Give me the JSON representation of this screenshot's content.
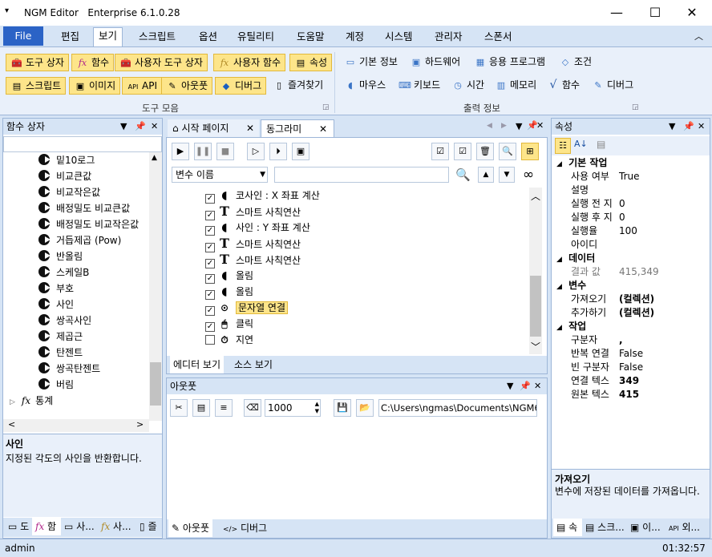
{
  "window": {
    "title": "NGM Editor   Enterprise 6.1.0.28",
    "minimize": "—",
    "maximize": "☐",
    "close": "✕"
  },
  "menu": {
    "file": "File",
    "items": [
      "편집",
      "보기",
      "스크립트",
      "옵션",
      "유틸리티",
      "도움말",
      "계정",
      "시스템",
      "관리자",
      "스폰서"
    ],
    "active_index": 1
  },
  "ribbon": {
    "toolbox_buttons": [
      {
        "label": "도구 상자",
        "icon": "toolbox-icon"
      },
      {
        "label": "함수",
        "icon": "fx-icon"
      },
      {
        "label": "사용자 도구 상자",
        "icon": "user-toolbox-icon"
      },
      {
        "label": "사용자 함수",
        "icon": "user-fx-icon"
      },
      {
        "label": "속성",
        "icon": "properties-icon"
      },
      {
        "label": "스크립트",
        "icon": "script-icon"
      },
      {
        "label": "이미지",
        "icon": "image-icon"
      },
      {
        "label": "API",
        "icon": "api-icon"
      },
      {
        "label": "아웃풋",
        "icon": "output-icon"
      },
      {
        "label": "디버그",
        "icon": "debug-icon"
      },
      {
        "label": "즐겨찾기",
        "icon": "favorites-icon"
      }
    ],
    "toolbox_group_label": "도구 모음",
    "output_buttons": [
      {
        "label": "기본 정보",
        "icon": "monitor-icon"
      },
      {
        "label": "하드웨어",
        "icon": "hardware-icon"
      },
      {
        "label": "응용 프로그램",
        "icon": "app-icon"
      },
      {
        "label": "조건",
        "icon": "condition-icon"
      },
      {
        "label": "마우스",
        "icon": "mouse-icon"
      },
      {
        "label": "키보드",
        "icon": "keyboard-icon"
      },
      {
        "label": "시간",
        "icon": "clock-icon"
      },
      {
        "label": "메모리",
        "icon": "memory-icon"
      },
      {
        "label": "함수",
        "icon": "sqrt-icon"
      },
      {
        "label": "디버그",
        "icon": "debug-icon"
      }
    ],
    "output_group_label": "출력 정보"
  },
  "function_box": {
    "title": "함수 상자",
    "items": [
      "밑10로그",
      "비교큰값",
      "비교작은값",
      "배정밀도 비교큰값",
      "배정밀도 비교작은값",
      "거듭제곱 (Pow)",
      "반올림",
      "스케일B",
      "부호",
      "사인",
      "쌍곡사인",
      "제곱근",
      "탄젠트",
      "쌍곡탄젠트",
      "버림"
    ],
    "category": "통계",
    "desc_title": "사인",
    "desc_text": "지정된 각도의 사인을 반환합니다.",
    "bottom_tabs": [
      "도",
      "함",
      "사...",
      "사...",
      "즐"
    ]
  },
  "editor": {
    "tabs": [
      "시작 페이지",
      "동그라미"
    ],
    "variable_select": "변수 이름",
    "search_value": "",
    "rows": [
      {
        "checked": true,
        "icon": "pac",
        "text": "코사인 : X 좌표 계산"
      },
      {
        "checked": true,
        "icon": "T",
        "text": "스마트 사칙연산"
      },
      {
        "checked": true,
        "icon": "pac",
        "text": "사인 : Y 좌표 계산"
      },
      {
        "checked": true,
        "icon": "T",
        "text": "스마트 사칙연산"
      },
      {
        "checked": true,
        "icon": "T",
        "text": "스마트 사칙연산"
      },
      {
        "checked": true,
        "icon": "pac",
        "text": "올림"
      },
      {
        "checked": true,
        "icon": "pac",
        "text": "올림"
      },
      {
        "checked": true,
        "icon": "dots",
        "text": "문자열 연결",
        "selected": true
      },
      {
        "checked": true,
        "icon": "mouse",
        "text": "클릭"
      },
      {
        "checked": false,
        "icon": "timer",
        "text": "지연"
      }
    ],
    "bottom_tabs": [
      "에디터 보기",
      "소스 보기"
    ]
  },
  "output": {
    "title": "아웃풋",
    "spin_value": "1000",
    "path": "C:\\Users\\ngmas\\Documents\\NGM6\\",
    "bottom_tabs": [
      "아웃풋",
      "디버그"
    ]
  },
  "properties": {
    "title": "속성",
    "sections": [
      {
        "name": "기본 작업",
        "rows": [
          [
            "사용 여부",
            "True"
          ],
          [
            "설명",
            ""
          ],
          [
            "실행 전 지",
            "0"
          ],
          [
            "실행 후 지",
            "0"
          ],
          [
            "실행율",
            "100"
          ],
          [
            "아이디",
            ""
          ]
        ]
      },
      {
        "name": "데이터",
        "rows": [
          [
            "결과 값",
            "415,349"
          ]
        ]
      },
      {
        "name": "변수",
        "rows": [
          [
            "가져오기",
            "(컬렉션)"
          ],
          [
            "추가하기",
            "(컬렉션)"
          ]
        ]
      },
      {
        "name": "작업",
        "rows": [
          [
            "구분자",
            ","
          ],
          [
            "반복 연결",
            "False"
          ],
          [
            "빈 구분자",
            "False"
          ],
          [
            "연결 텍스",
            "349"
          ],
          [
            "원본 텍스",
            "415"
          ]
        ]
      }
    ],
    "desc_title": "가져오기",
    "desc_text": "변수에 저장된 데이터를 가져옵니다.",
    "bottom_tabs": [
      "속",
      "스크...",
      "이...",
      "외..."
    ]
  },
  "status": {
    "user": "admin",
    "time": "01:32:57"
  }
}
